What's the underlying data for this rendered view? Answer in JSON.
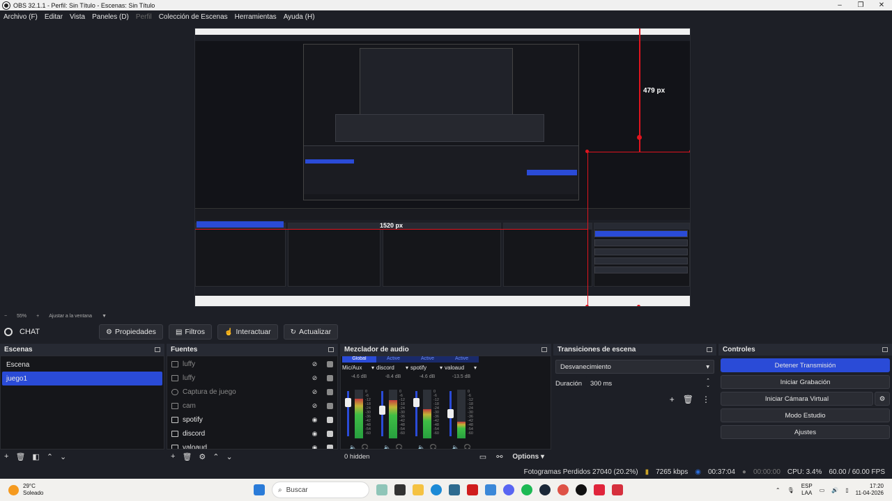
{
  "window": {
    "title": "OBS 32.1.1 - Perfil: Sin Título - Escenas: Sin Título",
    "controls": [
      "–",
      "❐",
      "✕"
    ]
  },
  "menu": [
    {
      "label": "Archivo (F)",
      "disabled": false
    },
    {
      "label": "Editar",
      "disabled": false
    },
    {
      "label": "Vista",
      "disabled": false
    },
    {
      "label": "Paneles (D)",
      "disabled": false
    },
    {
      "label": "Perfil",
      "disabled": true
    },
    {
      "label": "Colección de Escenas",
      "disabled": false
    },
    {
      "label": "Herramientas",
      "disabled": false
    },
    {
      "label": "Ayuda (H)",
      "disabled": false
    }
  ],
  "preview": {
    "measure_vertical": "479 px",
    "measure_horizontal": "1520 px",
    "zoom_level": "55%",
    "zoom_label": "Ajustar a la ventana"
  },
  "context_bar": {
    "source_name": "CHAT",
    "buttons": {
      "properties": "Propiedades",
      "filters": "Filtros",
      "interact": "Interactuar",
      "refresh": "Actualizar"
    }
  },
  "scenes": {
    "title": "Escenas",
    "items": [
      {
        "label": "Escena",
        "active": false
      },
      {
        "label": "juego1",
        "active": true
      }
    ]
  },
  "sources": {
    "title": "Fuentes",
    "items": [
      {
        "label": "luffy",
        "visible": false
      },
      {
        "label": "luffy",
        "visible": false
      },
      {
        "label": "Captura de juego",
        "visible": false
      },
      {
        "label": "cam",
        "visible": false
      },
      {
        "label": "spotify",
        "visible": true
      },
      {
        "label": "discord",
        "visible": true
      },
      {
        "label": "valoaud",
        "visible": true
      }
    ]
  },
  "mixer": {
    "title": "Mezclador de audio",
    "tabs": [
      "Global",
      "Active",
      "Active",
      "Active"
    ],
    "channels": [
      {
        "name": "Mic/Aux",
        "db": "-4.6 dB",
        "volume": 0.8,
        "level": 0.82
      },
      {
        "name": "discord",
        "db": "-8.4 dB",
        "volume": 0.6,
        "level": 0.78
      },
      {
        "name": "spotify",
        "db": "-4.6 dB",
        "volume": 0.8,
        "level": 0.6
      },
      {
        "name": "valoaud",
        "db": "-13.5 dB",
        "volume": 0.5,
        "level": 0.35
      }
    ],
    "scale": [
      "0",
      "-6",
      "-12",
      "-18",
      "-24",
      "-30",
      "-36",
      "-42",
      "-48",
      "-54",
      "-60"
    ],
    "hidden_label": "0 hidden",
    "options_label": "Options"
  },
  "transitions": {
    "title": "Transiciones de escena",
    "selected": "Desvanecimiento",
    "duration_label": "Duración",
    "duration_value": "300 ms"
  },
  "controls": {
    "title": "Controles",
    "buttons": [
      {
        "label": "Detener Transmisión",
        "primary": true
      },
      {
        "label": "Iniciar Grabación",
        "primary": false
      },
      {
        "label": "Iniciar Cámara Virtual",
        "primary": false
      },
      {
        "label": "Modo Estudio",
        "primary": false
      },
      {
        "label": "Ajustes",
        "primary": false
      }
    ]
  },
  "status": {
    "dropped_frames": "Fotogramas Perdidos 27040 (20.2%)",
    "bitrate": "7265 kbps",
    "stream_time": "00:37:04",
    "record_time": "00:00:00",
    "cpu": "CPU: 3.4%",
    "fps": "60.00 / 60.00 FPS"
  },
  "taskbar": {
    "temperature": "29°C",
    "weather": "Soleado",
    "search_placeholder": "Buscar",
    "language": "ESP",
    "keyboard": "LAA",
    "time": "17:20",
    "date": "11-04-2026"
  },
  "colors": {
    "accent": "#2a4bd7",
    "measure_red": "#e0141e"
  }
}
